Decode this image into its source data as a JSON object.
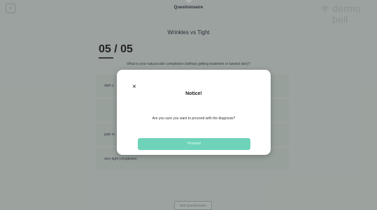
{
  "header": {
    "back_icon": "chevron-left-icon",
    "title": "Questionnaire",
    "wifi_icon": "wifi-icon",
    "brand": "dermo bell"
  },
  "main": {
    "section_title": "Wrinkles vs Tight",
    "progress_current": "05",
    "progress_separator": "/",
    "progress_total": "05",
    "progress_text": "05 / 05",
    "question": "What is your natural skin complexion (without getting treatment or tanned skin)?",
    "options": [
      {
        "label": "dark s"
      },
      {
        "label": ""
      },
      {
        "label": "pale m"
      },
      {
        "label": "very light complexion"
      }
    ],
    "submit_label": "Risk Questionnaire"
  },
  "dialog": {
    "close_symbol": "×",
    "title": "Notice!",
    "message": "Are you sure you want to proceed with the diagnosis?",
    "proceed_label": "Proceed"
  },
  "colors": {
    "background": "#dfe9e4",
    "accent": "#6ed3b9",
    "overlay": "rgba(0,0,0,0.30)"
  }
}
